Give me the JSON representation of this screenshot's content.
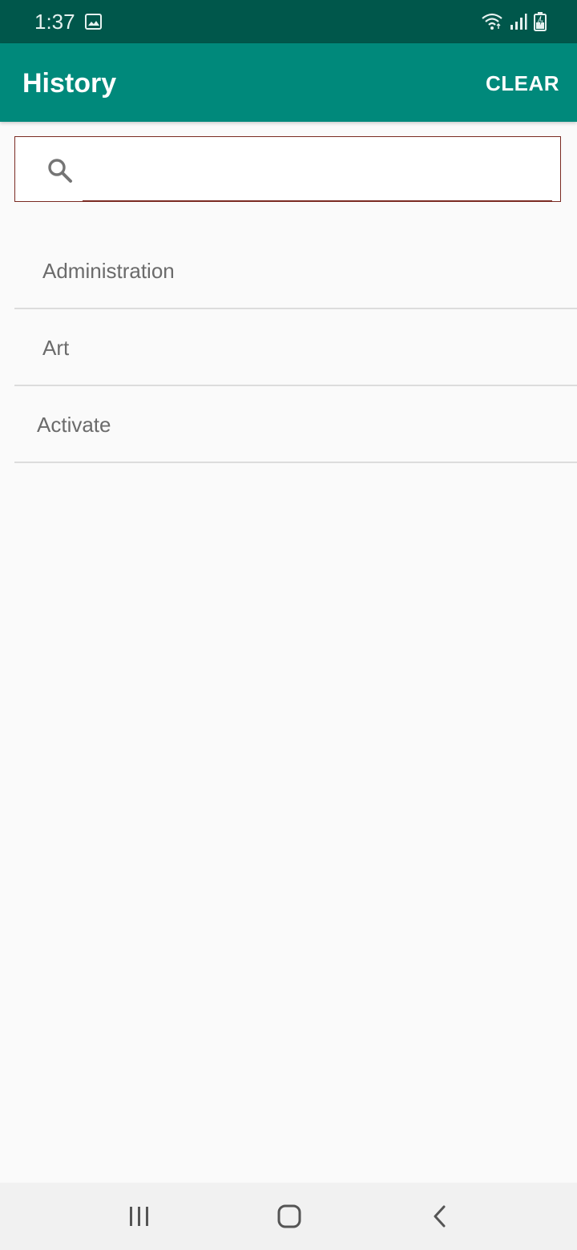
{
  "status_bar": {
    "time": "1:37",
    "icons": [
      "gallery-icon",
      "wifi-icon",
      "signal-icon",
      "battery-charging-icon"
    ]
  },
  "app_bar": {
    "title": "History",
    "clear_label": "CLEAR",
    "background_color": "#00897b",
    "status_color": "#00574b"
  },
  "search": {
    "value": "",
    "placeholder": ""
  },
  "history": {
    "items": [
      {
        "label": "Administration"
      },
      {
        "label": "Art"
      },
      {
        "label": "Activate"
      }
    ]
  },
  "nav_bar": {
    "icons": [
      "recent-apps-icon",
      "home-icon",
      "back-icon"
    ]
  }
}
